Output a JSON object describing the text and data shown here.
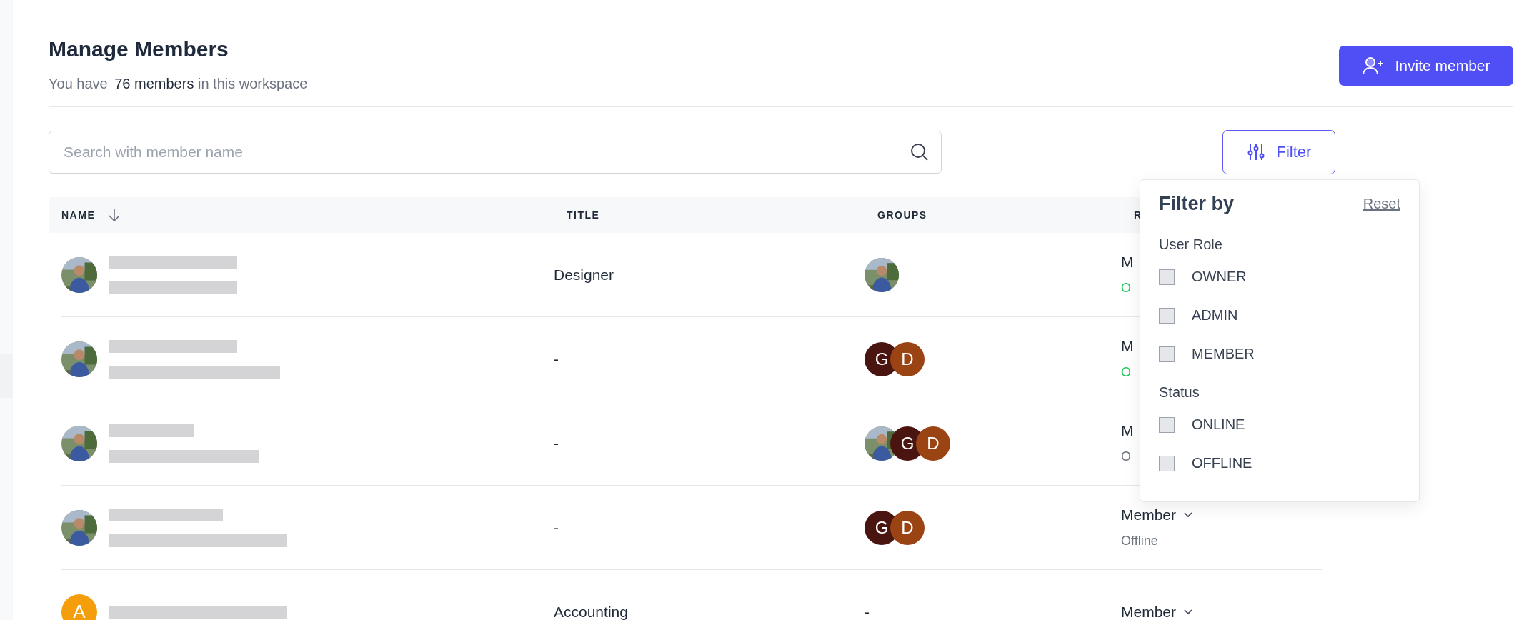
{
  "header": {
    "title": "Manage Members",
    "subtitle": {
      "prefix": "You have",
      "count": "76 members",
      "suffix": "in this workspace"
    }
  },
  "invite_button": {
    "label": "Invite member"
  },
  "search": {
    "placeholder": "Search with member name"
  },
  "filter_button": {
    "label": "Filter"
  },
  "table": {
    "columns": [
      {
        "label": "NAME",
        "sorted": true
      },
      {
        "label": "TITLE",
        "sorted": false
      },
      {
        "label": "GROUPS",
        "sorted": false
      },
      {
        "label": "R",
        "sorted": false
      }
    ],
    "rows": [
      {
        "avatar": {
          "kind": "picture"
        },
        "title": "Designer",
        "groups": [
          {
            "kind": "picture"
          }
        ],
        "role": "M",
        "status": "O",
        "online": true,
        "dropdown": false
      },
      {
        "avatar": {
          "kind": "picture"
        },
        "title": "-",
        "groups": [
          {
            "kind": "letter",
            "letter": "G",
            "color": "#4a1511"
          },
          {
            "kind": "letter",
            "letter": "D",
            "color": "#9a4313"
          }
        ],
        "role": "M",
        "status": "O",
        "online": true,
        "dropdown": false
      },
      {
        "avatar": {
          "kind": "picture"
        },
        "title": "-",
        "groups": [
          {
            "kind": "picture"
          },
          {
            "kind": "letter",
            "letter": "G",
            "color": "#4a1511"
          },
          {
            "kind": "letter",
            "letter": "D",
            "color": "#9a4313"
          }
        ],
        "role": "M",
        "status": "O",
        "online": false,
        "dropdown": false
      },
      {
        "avatar": {
          "kind": "picture"
        },
        "title": "-",
        "groups": [
          {
            "kind": "letter",
            "letter": "G",
            "color": "#4a1511"
          },
          {
            "kind": "letter",
            "letter": "D",
            "color": "#9a4313"
          }
        ],
        "role": "Member",
        "status": "Offline",
        "online": false,
        "dropdown": true
      },
      {
        "avatar": {
          "kind": "letter",
          "letter": "A",
          "color": "#f59e0b"
        },
        "title": "Accounting",
        "groups_text": "-",
        "role": "Member",
        "dropdown": true
      }
    ]
  },
  "filter_menu": {
    "title": "Filter by",
    "reset": "Reset",
    "sections": [
      {
        "label": "User Role",
        "options": [
          {
            "label": "OWNER",
            "checked": false
          },
          {
            "label": "ADMIN",
            "checked": false
          },
          {
            "label": "MEMBER",
            "checked": false
          }
        ]
      },
      {
        "label": "Status",
        "options": [
          {
            "label": "ONLINE",
            "checked": false
          },
          {
            "label": "OFFLINE",
            "checked": false
          }
        ]
      }
    ]
  }
}
